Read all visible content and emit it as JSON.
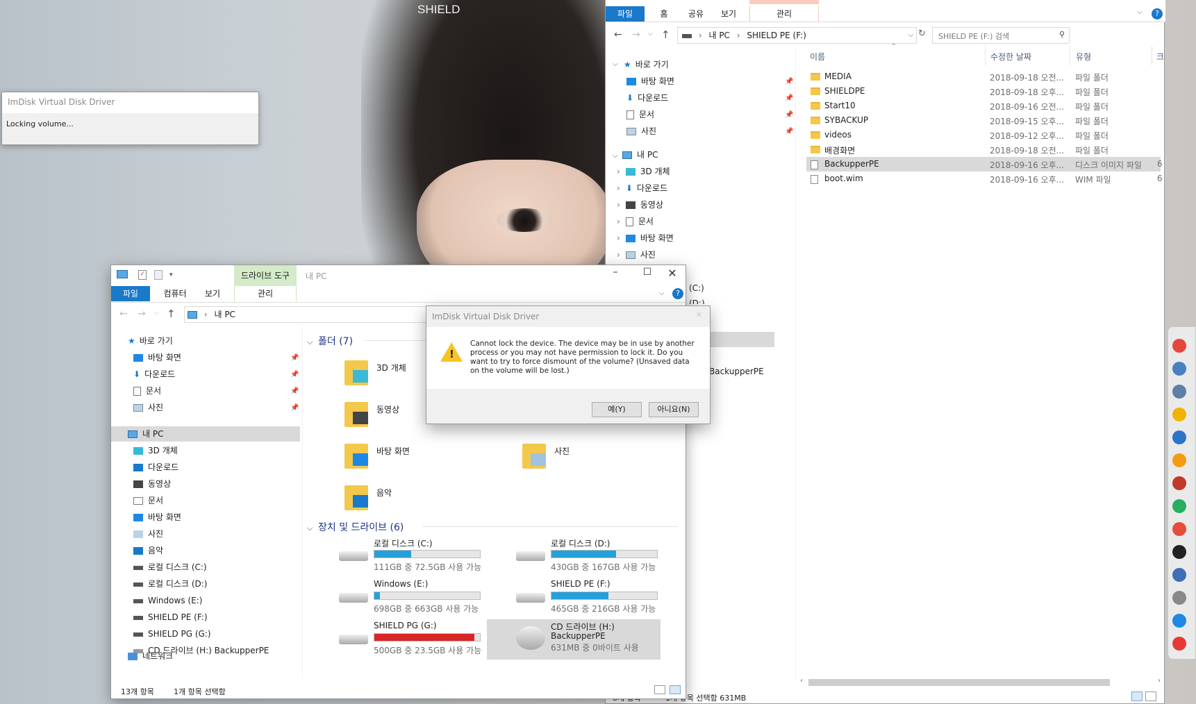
{
  "desktop": {
    "wallpaper_text": "SHIELD"
  },
  "progress_window": {
    "title": "ImDisk Virtual Disk Driver",
    "message": "Locking volume..."
  },
  "right_explorer": {
    "ribbon_tabs": [
      "파일",
      "홈",
      "공유",
      "보기",
      "관리"
    ],
    "address": {
      "segments": [
        "내 PC",
        "SHIELD PE (F:)"
      ],
      "search_placeholder": "SHIELD PE (F:) 검색"
    },
    "nav": {
      "quick_access": "바로 가기",
      "quick_items": [
        "바탕 화면",
        "다운로드",
        "문서",
        "사진"
      ],
      "this_pc": "내 PC",
      "pc_items": [
        "3D 개체",
        "다운로드",
        "동영상",
        "문서",
        "바탕 화면",
        "사진"
      ],
      "partial_items": [
        "(C:)",
        "(D:)",
        "BackupperPE"
      ]
    },
    "columns": [
      "이름",
      "수정한 날짜",
      "유형",
      "크"
    ],
    "files": [
      {
        "name": "MEDIA",
        "date": "2018-09-18 오전...",
        "type": "파일 폴더",
        "size": "",
        "kind": "folder"
      },
      {
        "name": "SHIELDPE",
        "date": "2018-09-18 오후...",
        "type": "파일 폴더",
        "size": "",
        "kind": "folder"
      },
      {
        "name": "Start10",
        "date": "2018-09-16 오전...",
        "type": "파일 폴더",
        "size": "",
        "kind": "folder"
      },
      {
        "name": "SYBACKUP",
        "date": "2018-09-15 오후...",
        "type": "파일 폴더",
        "size": "",
        "kind": "folder"
      },
      {
        "name": "videos",
        "date": "2018-09-12 오후...",
        "type": "파일 폴더",
        "size": "",
        "kind": "folder"
      },
      {
        "name": "배경화면",
        "date": "2018-09-18 오전...",
        "type": "파일 폴더",
        "size": "",
        "kind": "folder"
      },
      {
        "name": "BackupperPE",
        "date": "2018-09-16 오후...",
        "type": "디스크 이미지 파일",
        "size": "6",
        "kind": "image",
        "selected": true
      },
      {
        "name": "boot.wim",
        "date": "2018-09-16 오후...",
        "type": "WIM 파일",
        "size": "6",
        "kind": "file"
      }
    ],
    "status": {
      "count": "8개 항목",
      "selected": "1개 항목 선택함 631MB"
    }
  },
  "left_explorer": {
    "qat_title": "내 PC",
    "drive_tools": "드라이브 도구",
    "ribbon_tabs": [
      "파일",
      "컴퓨터",
      "보기",
      "관리"
    ],
    "address": "내 PC",
    "nav": {
      "quick_access": "바로 가기",
      "quick_items": [
        "바탕 화면",
        "다운로드",
        "문서",
        "사진"
      ],
      "this_pc": "내 PC",
      "pc_items": [
        "3D 개체",
        "다운로드",
        "동영상",
        "문서",
        "바탕 화면",
        "사진",
        "음악",
        "로컬 디스크 (C:)",
        "로컬 디스크 (D:)",
        "Windows (E:)",
        "SHIELD PE (F:)",
        "SHIELD PG (G:)",
        "CD 드라이브 (H:) BackupperPE"
      ],
      "network": "네트워크"
    },
    "folders_header": "폴더 (7)",
    "folders": [
      "3D 개체",
      "동영상",
      "바탕 화면",
      "사진",
      "음악"
    ],
    "drives_header": "장치 및 드라이브 (6)",
    "drives": [
      {
        "name": "로컬 디스크 (C:)",
        "info": "111GB 중 72.5GB 사용 가능",
        "used_fraction": 0.35,
        "color": "#26a0da"
      },
      {
        "name": "로컬 디스크 (D:)",
        "info": "430GB 중 167GB 사용 가능",
        "used_fraction": 0.61,
        "color": "#26a0da"
      },
      {
        "name": "Windows (E:)",
        "info": "698GB 중 663GB 사용 가능",
        "used_fraction": 0.05,
        "color": "#26a0da"
      },
      {
        "name": "SHIELD PE (F:)",
        "info": "465GB 중 216GB 사용 가능",
        "used_fraction": 0.54,
        "color": "#26a0da"
      },
      {
        "name": "SHIELD PG (G:)",
        "info": "500GB 중 23.5GB 사용 가능",
        "used_fraction": 0.95,
        "color": "#da2626"
      },
      {
        "name": "CD 드라이브 (H:)",
        "label": "BackupperPE",
        "info": "631MB 중 0바이트 사용"
      }
    ],
    "status": {
      "count": "13개 항목",
      "selected": "1개 항목 선택함"
    }
  },
  "dialog": {
    "title": "ImDisk Virtual Disk Driver",
    "message": "Cannot lock the device. The device may be in use by another process or you may not have permission to lock it. Do you want to try to force dismount of the volume? (Unsaved data on the volume will be lost.)",
    "yes": "예(Y)",
    "no": "아니요(N)"
  },
  "taskbar_icons": [
    "chrome-icon",
    "folder-icon",
    "folder-icon",
    "app-icon",
    "app-icon",
    "player-icon",
    "app-icon",
    "app-icon",
    "app-icon",
    "app-icon",
    "monitor-icon",
    "app-icon",
    "app-icon",
    "power-icon"
  ]
}
